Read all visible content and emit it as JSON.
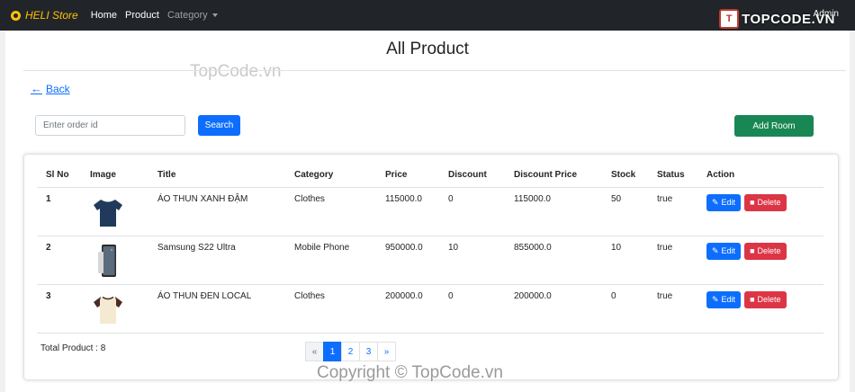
{
  "navbar": {
    "brand": "HELI Store",
    "links": [
      "Home",
      "Product"
    ],
    "category_label": "Category",
    "admin_label": "Admin"
  },
  "watermark": {
    "logo_text": "TOPCODE.VN",
    "logo_mark": "T",
    "top_text": "TopCode.vn",
    "bottom_text": "Copyright © TopCode.vn"
  },
  "page": {
    "title": "All Product",
    "back_label": "Back",
    "search": {
      "placeholder": "Enter order id",
      "value": "",
      "button_label": "Search"
    },
    "add_button_label": "Add Room"
  },
  "table": {
    "headers": [
      "Sl No",
      "Image",
      "Title",
      "Category",
      "Price",
      "Discount",
      "Discount Price",
      "Stock",
      "Status",
      "Action"
    ],
    "rows": [
      {
        "slno": "1",
        "image": "tshirt-navy",
        "title": "ÁO THUN XANH ĐẬM",
        "category": "Clothes",
        "price": "115000.0",
        "discount": "0",
        "discount_price": "115000.0",
        "stock": "50",
        "status": "true"
      },
      {
        "slno": "2",
        "image": "phone",
        "title": "Samsung S22 Ultra",
        "category": "Mobile Phone",
        "price": "950000.0",
        "discount": "10",
        "discount_price": "855000.0",
        "stock": "10",
        "status": "true"
      },
      {
        "slno": "3",
        "image": "tshirt-cream",
        "title": "ÁO THUN ĐEN LOCAL",
        "category": "Clothes",
        "price": "200000.0",
        "discount": "0",
        "discount_price": "200000.0",
        "stock": "0",
        "status": "true"
      }
    ],
    "edit_label": "Edit",
    "delete_label": "Delete"
  },
  "footer": {
    "total_label": "Total Product : 8",
    "pagination": {
      "prev": "«",
      "pages": [
        "1",
        "2",
        "3"
      ],
      "active": "1",
      "next": "»"
    }
  },
  "colors": {
    "navbar_bg": "#212529",
    "brand": "#ffc107",
    "primary": "#0d6efd",
    "success": "#198754",
    "danger": "#dc3545"
  }
}
